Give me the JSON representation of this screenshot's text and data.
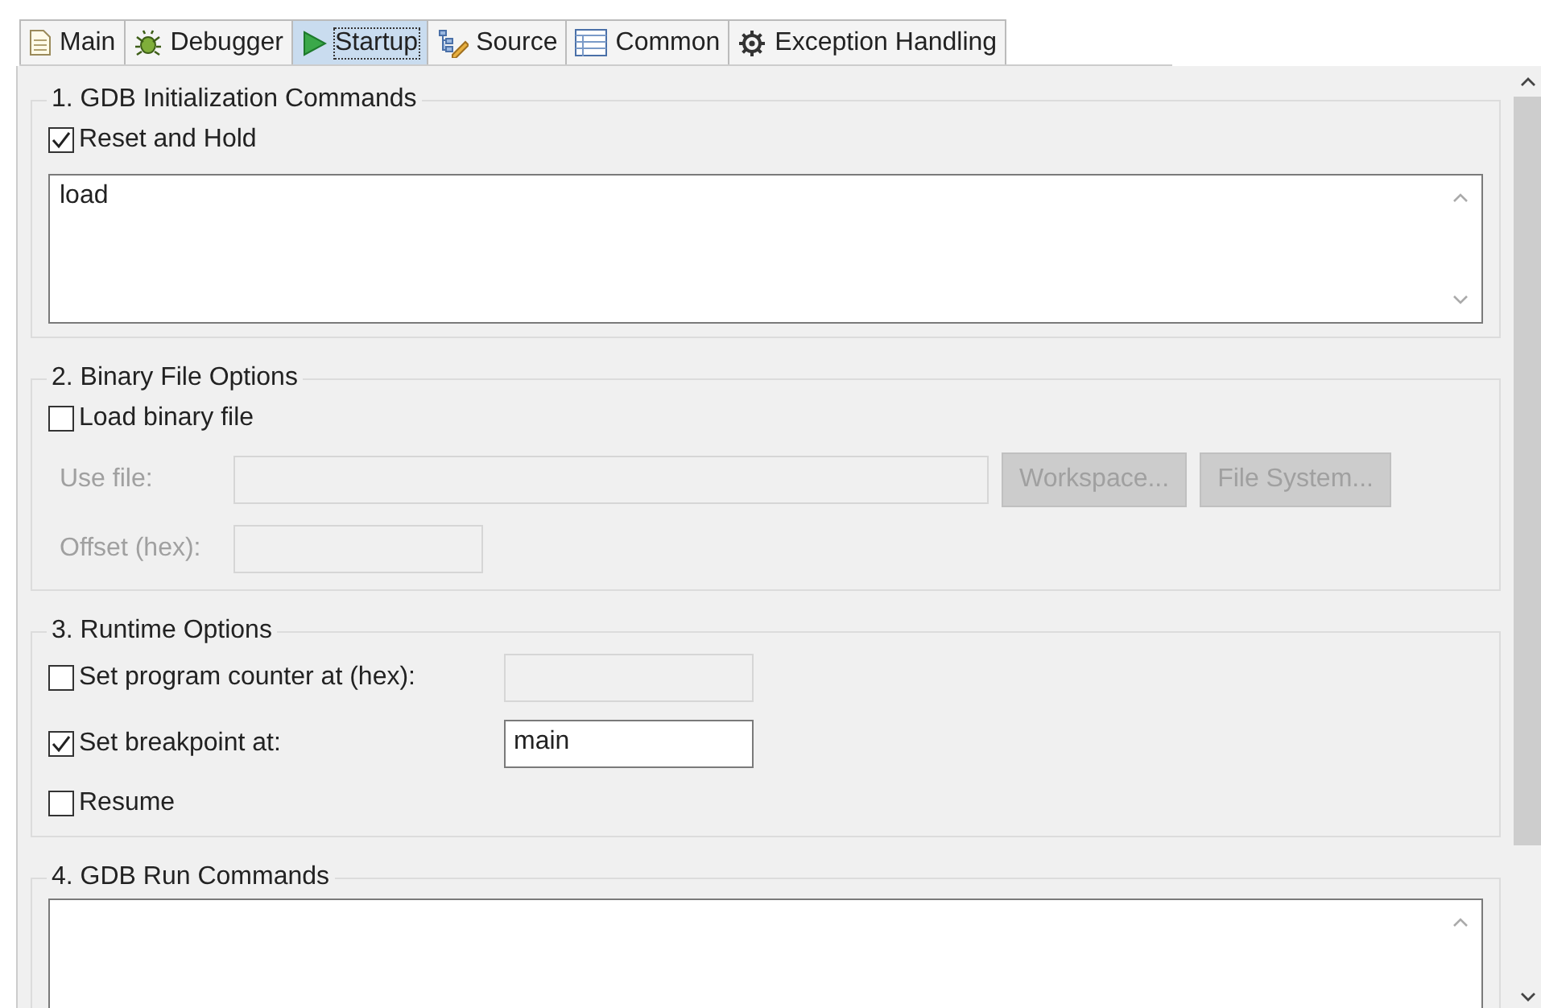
{
  "tabs": [
    {
      "label": "Main",
      "kind": "document",
      "selected": false
    },
    {
      "label": "Debugger",
      "kind": "bug",
      "selected": false
    },
    {
      "label": "Startup",
      "kind": "play",
      "selected": true
    },
    {
      "label": "Source",
      "kind": "tree",
      "selected": false
    },
    {
      "label": "Common",
      "kind": "table",
      "selected": false
    },
    {
      "label": "Exception Handling",
      "kind": "gear",
      "selected": false
    }
  ],
  "groups": [
    {
      "title": "1. GDB Initialization Commands",
      "items": [
        {
          "kind": "checkbox",
          "label": "Reset and Hold",
          "checked": true
        },
        {
          "kind": "textarea",
          "value": "load"
        }
      ]
    },
    {
      "title": "2. Binary File Options",
      "items": [
        {
          "kind": "checkbox",
          "label": "Load binary file",
          "checked": false
        },
        {
          "kind": "file",
          "label": "Use file:",
          "disabled": true,
          "buttons": [
            "Workspace...",
            "File System..."
          ]
        },
        {
          "kind": "field",
          "label": "Offset (hex):",
          "disabled": true
        }
      ]
    },
    {
      "title": "3. Runtime Options",
      "items": [
        {
          "kind": "checkfield",
          "label": "Set program counter at (hex):",
          "checked": false,
          "disabled": true
        },
        {
          "kind": "checkfield",
          "label": "Set breakpoint at:",
          "checked": true,
          "disabled": false,
          "value": "main"
        },
        {
          "kind": "checkbox",
          "label": "Resume",
          "checked": false
        }
      ]
    },
    {
      "title": "4. GDB Run Commands",
      "items": [
        {
          "kind": "textarea"
        }
      ]
    }
  ]
}
